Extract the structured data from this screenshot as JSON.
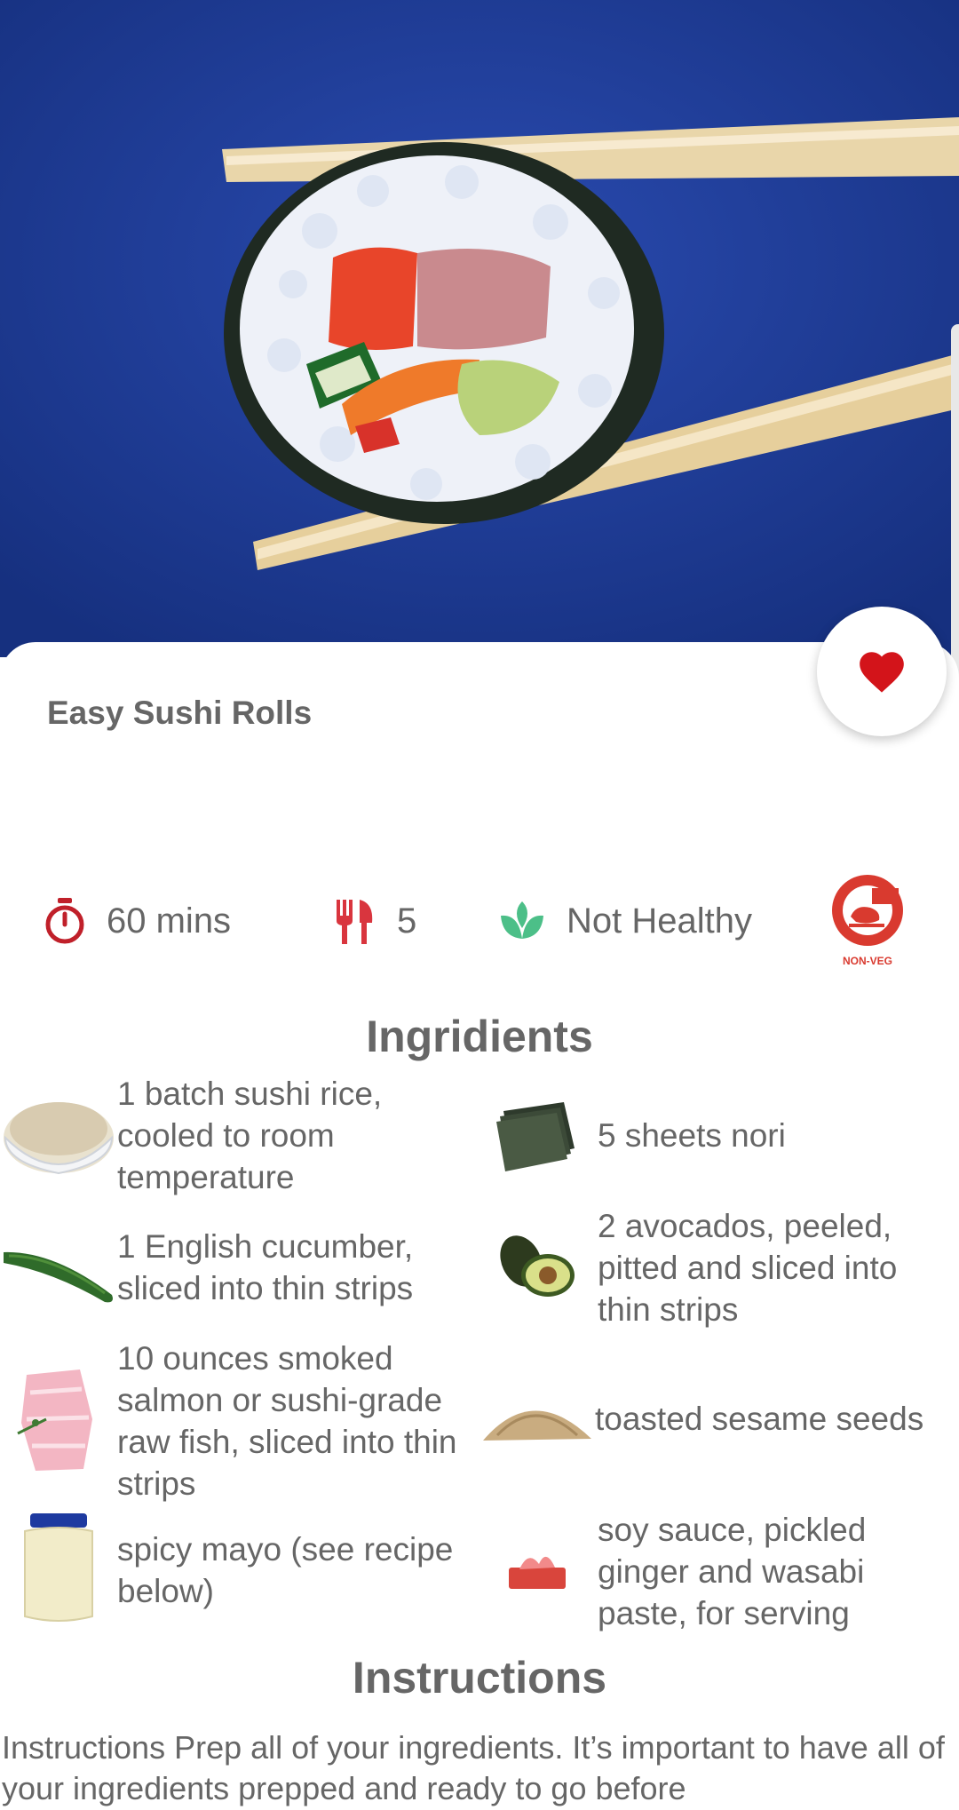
{
  "recipe": {
    "title": "Easy Sushi Rolls",
    "favorite": true
  },
  "stats": {
    "time": "60 mins",
    "servings": "5",
    "health": "Not Healthy",
    "diet_badge": "NON-VEG"
  },
  "ingredients_heading": "Ingridients",
  "ingredients": [
    {
      "text": "1 batch sushi rice, cooled to room temperature",
      "icon": "rice-bowl-icon"
    },
    {
      "text": "5 sheets nori",
      "icon": "nori-sheets-icon"
    },
    {
      "text": "1 English cucumber, sliced into thin strips",
      "icon": "cucumber-icon"
    },
    {
      "text": "2 avocados, peeled, pitted and sliced into thin strips",
      "icon": "avocado-icon"
    },
    {
      "text": "10 ounces smoked salmon or sushi-grade raw fish, sliced into thin strips",
      "icon": "raw-fish-icon"
    },
    {
      "text": "toasted sesame seeds",
      "icon": "sesame-seeds-icon"
    },
    {
      "text": "spicy mayo (see recipe below)",
      "icon": "mayo-jar-icon"
    },
    {
      "text": "soy sauce, pickled ginger and wasabi paste, for serving",
      "icon": "pickled-ginger-icon"
    }
  ],
  "instructions_heading": "Instructions",
  "instructions_text": "Instructions Prep all of your ingredients. It’s important to have all of your ingredients prepped and ready to go before",
  "colors": {
    "hero_bg": "#1d3a9c",
    "accent_red": "#c62828",
    "leaf_green": "#4cbf88",
    "text_gray": "#666666"
  }
}
